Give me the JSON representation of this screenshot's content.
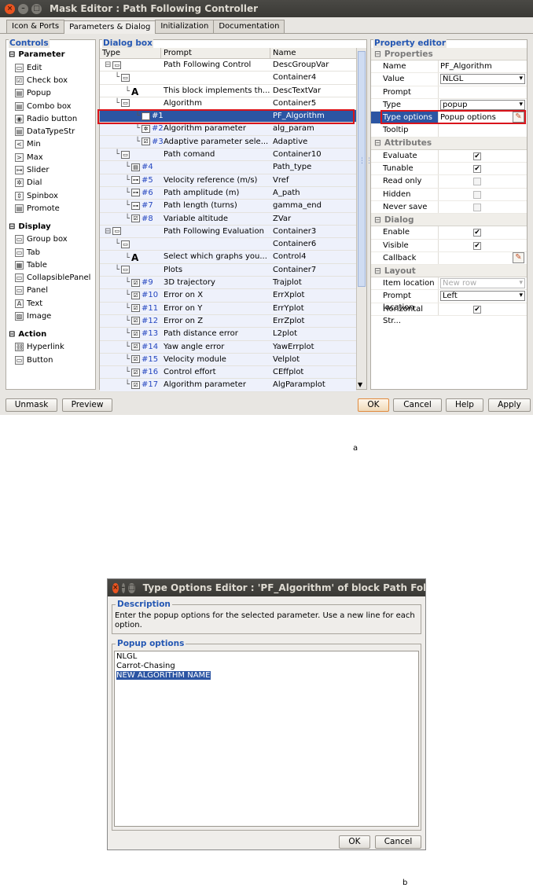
{
  "window": {
    "title": "Mask Editor : Path Following Controller"
  },
  "tabs": [
    "Icon & Ports",
    "Parameters & Dialog",
    "Initialization",
    "Documentation"
  ],
  "controls": {
    "title": "Controls",
    "parameter_header": "Parameter",
    "parameter_items": [
      "Edit",
      "Check box",
      "Popup",
      "Combo box",
      "Radio button",
      "DataTypeStr",
      "Min",
      "Max",
      "Slider",
      "Dial",
      "Spinbox",
      "Promote"
    ],
    "display_header": "Display",
    "display_items": [
      "Group box",
      "Tab",
      "Table",
      "CollapsiblePanel",
      "Panel",
      "Text",
      "Image"
    ],
    "action_header": "Action",
    "action_items": [
      "Hyperlink",
      "Button"
    ]
  },
  "dialog_box": {
    "title": "Dialog box",
    "columns": [
      "Type",
      "Prompt",
      "Name"
    ],
    "rows": [
      {
        "idx": "",
        "prompt": "Path Following Control",
        "name": "DescGroupVar"
      },
      {
        "idx": "",
        "prompt": "",
        "name": "Container4"
      },
      {
        "idx": "",
        "prompt": "This block implements th...",
        "name": "DescTextVar"
      },
      {
        "idx": "",
        "prompt": "Algorithm",
        "name": "Container5"
      },
      {
        "idx": "#1",
        "prompt": "",
        "name": "PF_Algorithm"
      },
      {
        "idx": "#2",
        "prompt": "Algorithm parameter",
        "name": "alg_param"
      },
      {
        "idx": "#3",
        "prompt": "Adaptive parameter sele...",
        "name": "Adaptive"
      },
      {
        "idx": "",
        "prompt": "Path comand",
        "name": "Container10"
      },
      {
        "idx": "#4",
        "prompt": "",
        "name": "Path_type"
      },
      {
        "idx": "#5",
        "prompt": "Velocity reference (m/s)",
        "name": "Vref"
      },
      {
        "idx": "#6",
        "prompt": "Path amplitude (m)",
        "name": "A_path"
      },
      {
        "idx": "#7",
        "prompt": "Path length (turns)",
        "name": "gamma_end"
      },
      {
        "idx": "#8",
        "prompt": "Variable altitude",
        "name": "ZVar"
      },
      {
        "idx": "",
        "prompt": "Path Following Evaluation",
        "name": "Container3"
      },
      {
        "idx": "",
        "prompt": "",
        "name": "Container6"
      },
      {
        "idx": "",
        "prompt": "Select which graphs you...",
        "name": "Control4"
      },
      {
        "idx": "",
        "prompt": "Plots",
        "name": "Container7"
      },
      {
        "idx": "#9",
        "prompt": "3D trajectory",
        "name": "Trajplot"
      },
      {
        "idx": "#10",
        "prompt": "Error on X",
        "name": "ErrXplot"
      },
      {
        "idx": "#11",
        "prompt": "Error on Y",
        "name": "ErrYplot"
      },
      {
        "idx": "#12",
        "prompt": "Error on Z",
        "name": "ErrZplot"
      },
      {
        "idx": "#13",
        "prompt": "Path distance error",
        "name": "L2plot"
      },
      {
        "idx": "#14",
        "prompt": "Yaw angle error",
        "name": "YawErrplot"
      },
      {
        "idx": "#15",
        "prompt": "Velocity module",
        "name": "Velplot"
      },
      {
        "idx": "#16",
        "prompt": "Control effort",
        "name": "CEffplot"
      },
      {
        "idx": "#17",
        "prompt": "Algorithm parameter",
        "name": "AlgParamplot"
      }
    ]
  },
  "property_editor": {
    "title": "Property editor",
    "sections": {
      "properties": "Properties",
      "attributes": "Attributes",
      "dialog": "Dialog",
      "layout": "Layout"
    },
    "properties": {
      "name_label": "Name",
      "name_value": "PF_Algorithm",
      "value_label": "Value",
      "value_value": "NLGL",
      "prompt_label": "Prompt",
      "type_label": "Type",
      "type_value": "popup",
      "type_options_label": "Type options",
      "type_options_value": "Popup options",
      "tooltip_label": "Tooltip"
    },
    "attributes": [
      "Evaluate",
      "Tunable",
      "Read only",
      "Hidden",
      "Never save"
    ],
    "dialog": {
      "enable": "Enable",
      "visible": "Visible",
      "callback": "Callback"
    },
    "layout": {
      "item_location_label": "Item location",
      "item_location_value": "New row",
      "prompt_location_label": "Prompt location",
      "prompt_location_value": "Left",
      "horizontal_label": "Horizontal Str..."
    }
  },
  "buttons": {
    "unmask": "Unmask",
    "preview": "Preview",
    "ok": "OK",
    "cancel": "Cancel",
    "help": "Help",
    "apply": "Apply"
  },
  "type_options_dialog": {
    "title": "Type Options Editor : 'PF_Algorithm' of block Path Following",
    "description_title": "Description",
    "description_text": "Enter the popup options for the selected parameter. Use a new line for each option.",
    "options_title": "Popup options",
    "options": [
      "NLGL",
      "Carrot-Chasing",
      "NEW ALGORITHM NAME"
    ],
    "ok": "OK",
    "cancel": "Cancel"
  },
  "captions": {
    "fig_a": "a",
    "fig_b": "b"
  }
}
